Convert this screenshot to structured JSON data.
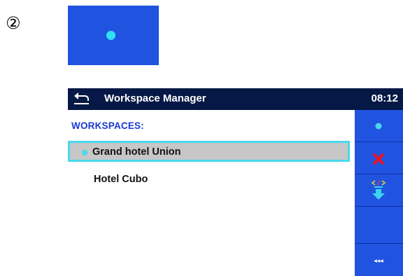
{
  "step_marker": "②",
  "header": {
    "title": "Workspace Manager",
    "time": "08:12"
  },
  "list": {
    "heading": "WORKSPACES:",
    "items": [
      {
        "label": "Grand hotel Union",
        "active": true,
        "selected": true
      },
      {
        "label": "Hotel Cubo",
        "active": false,
        "selected": false
      }
    ]
  },
  "sidebar": {
    "buttons": [
      {
        "icon": "active-dot-icon"
      },
      {
        "icon": "delete-x-icon"
      },
      {
        "icon": "export-icon"
      },
      {
        "icon": "more-options-icon",
        "label": "◂◂◂"
      }
    ]
  },
  "colors": {
    "accent_blue": "#2054e0",
    "highlight_cyan": "#49d8ec",
    "titlebar_navy": "#061845",
    "delete_red": "#e8121f",
    "heading_blue": "#1a38d6"
  }
}
